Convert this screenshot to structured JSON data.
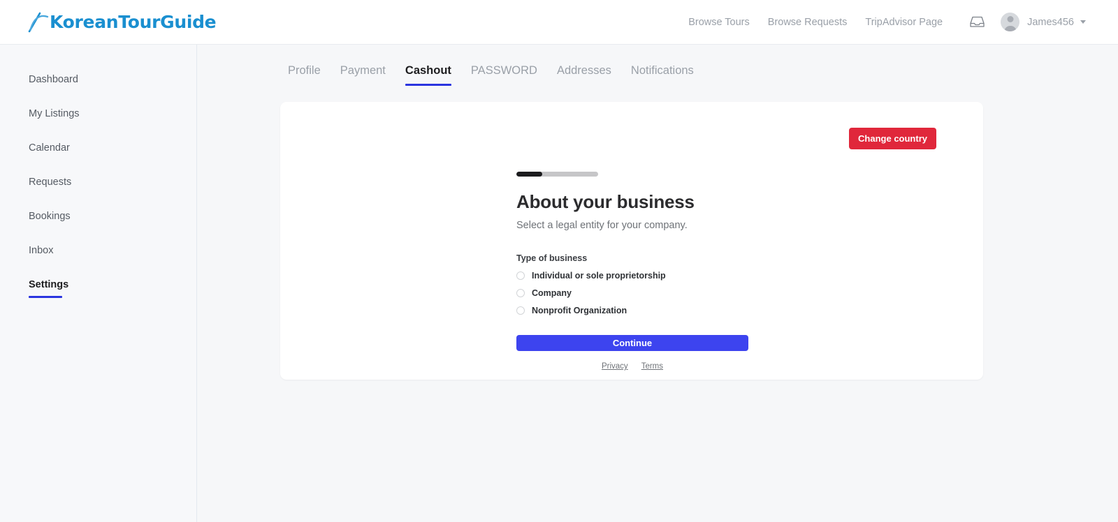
{
  "brand": {
    "logo_text": "KoreanTourGuide",
    "logo_color": "#1a8fd0"
  },
  "header": {
    "nav_links": [
      {
        "label": "Browse Tours"
      },
      {
        "label": "Browse Requests"
      },
      {
        "label": "TripAdvisor Page"
      }
    ],
    "inbox_icon": "inbox-icon",
    "user": {
      "name": "James456",
      "avatar_icon": "user-avatar-icon",
      "caret_icon": "chevron-down-icon"
    }
  },
  "sidebar": {
    "items": [
      {
        "label": "Dashboard",
        "active": false
      },
      {
        "label": "My Listings",
        "active": false
      },
      {
        "label": "Calendar",
        "active": false
      },
      {
        "label": "Requests",
        "active": false
      },
      {
        "label": "Bookings",
        "active": false
      },
      {
        "label": "Inbox",
        "active": false
      },
      {
        "label": "Settings",
        "active": true
      }
    ]
  },
  "tabs": [
    {
      "label": "Profile",
      "active": false
    },
    {
      "label": "Payment",
      "active": false
    },
    {
      "label": "Cashout",
      "active": true
    },
    {
      "label": "PASSWORD",
      "active": false
    },
    {
      "label": "Addresses",
      "active": false
    },
    {
      "label": "Notifications",
      "active": false
    }
  ],
  "card": {
    "change_country_label": "Change country",
    "change_country_color": "#e0273b",
    "progress_percent": 32,
    "title": "About your business",
    "subtitle": "Select a legal entity for your company.",
    "field_label": "Type of business",
    "options": [
      {
        "label": "Individual or sole proprietorship",
        "selected": false
      },
      {
        "label": "Company",
        "selected": false
      },
      {
        "label": "Nonprofit Organization",
        "selected": false
      }
    ],
    "continue_label": "Continue",
    "continue_color": "#3d44ef",
    "legal_links": [
      {
        "label": "Privacy"
      },
      {
        "label": "Terms"
      }
    ]
  }
}
